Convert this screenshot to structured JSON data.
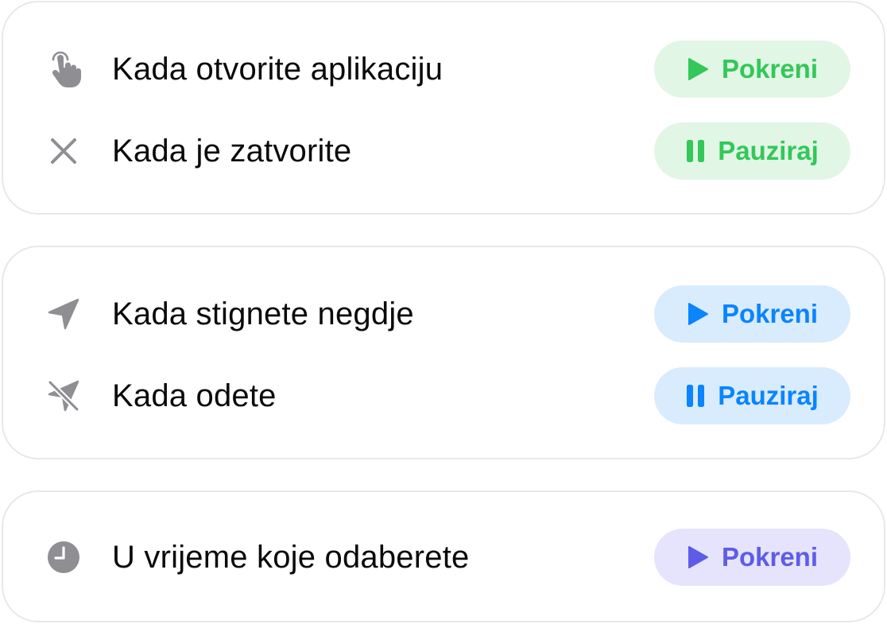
{
  "groups": [
    {
      "rows": [
        {
          "icon": "hand-tap-icon",
          "label": "Kada otvorite aplikaciju",
          "action": "Pokreni",
          "action_icon": "play-icon",
          "color": "#34c759"
        },
        {
          "icon": "close-x-icon",
          "label": "Kada je zatvorite",
          "action": "Pauziraj",
          "action_icon": "pause-icon",
          "color": "#34c759"
        }
      ]
    },
    {
      "rows": [
        {
          "icon": "location-arrow-icon",
          "label": "Kada stignete negdje",
          "action": "Pokreni",
          "action_icon": "play-icon",
          "color": "#0a84ff"
        },
        {
          "icon": "location-slash-icon",
          "label": "Kada odete",
          "action": "Pauziraj",
          "action_icon": "pause-icon",
          "color": "#0a84ff"
        }
      ]
    },
    {
      "rows": [
        {
          "icon": "clock-icon",
          "label": "U vrijeme koje odaberete",
          "action": "Pokreni",
          "action_icon": "play-icon",
          "color": "#5e5ce6"
        }
      ]
    }
  ],
  "colors": {
    "icon_gray": "#8e8e93",
    "green": "#34c759",
    "blue": "#0a84ff",
    "purple": "#5e5ce6"
  }
}
